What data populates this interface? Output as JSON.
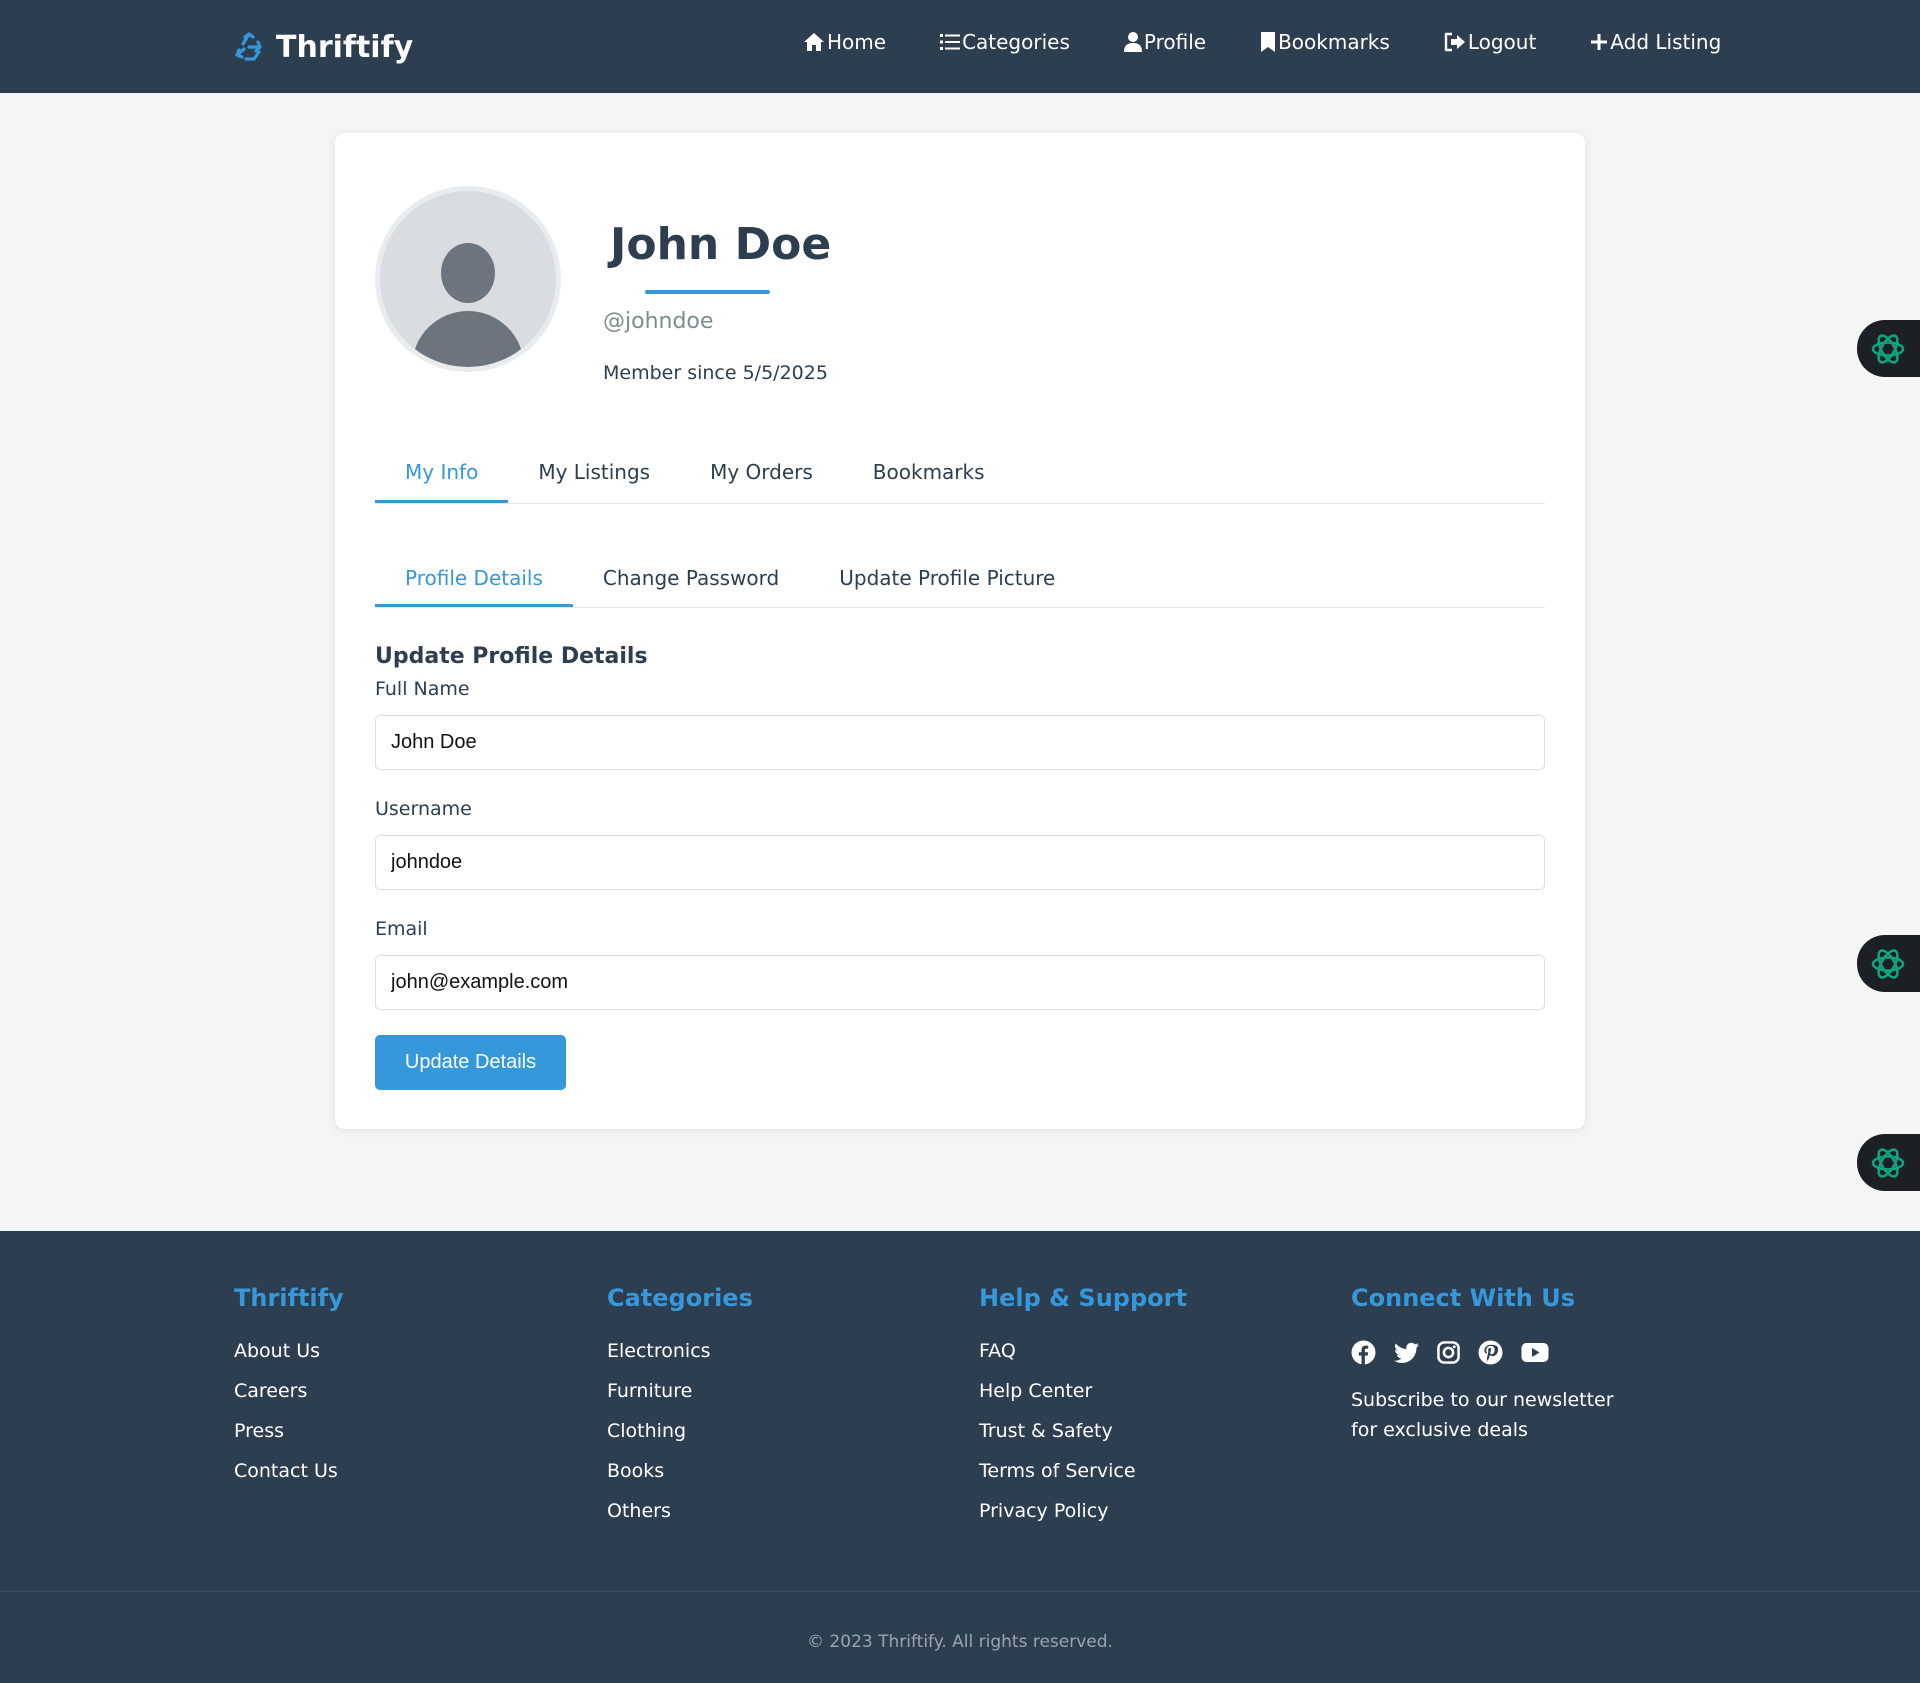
{
  "header": {
    "brand": "Thriftify",
    "nav": [
      {
        "label": "Home",
        "icon": "home-icon"
      },
      {
        "label": "Categories",
        "icon": "list-icon"
      },
      {
        "label": "Profile",
        "icon": "user-icon"
      },
      {
        "label": "Bookmarks",
        "icon": "bookmark-icon"
      },
      {
        "label": "Logout",
        "icon": "logout-icon"
      },
      {
        "label": "Add Listing",
        "icon": "plus-icon"
      }
    ]
  },
  "profile": {
    "name": "John Doe",
    "handle": "@johndoe",
    "member_since": "Member since 5/5/2025"
  },
  "tabs": {
    "primary": [
      "My Info",
      "My Listings",
      "My Orders",
      "Bookmarks"
    ],
    "secondary": [
      "Profile Details",
      "Change Password",
      "Update Profile Picture"
    ]
  },
  "form": {
    "title": "Update Profile Details",
    "full_name_label": "Full Name",
    "full_name_value": "John Doe",
    "username_label": "Username",
    "username_value": "johndoe",
    "email_label": "Email",
    "email_value": "john@example.com",
    "submit_label": "Update Details"
  },
  "footer": {
    "col1": {
      "title": "Thriftify",
      "links": [
        "About Us",
        "Careers",
        "Press",
        "Contact Us"
      ]
    },
    "col2": {
      "title": "Categories",
      "links": [
        "Electronics",
        "Furniture",
        "Clothing",
        "Books",
        "Others"
      ]
    },
    "col3": {
      "title": "Help & Support",
      "links": [
        "FAQ",
        "Help Center",
        "Trust & Safety",
        "Terms of Service",
        "Privacy Policy"
      ]
    },
    "col4": {
      "title": "Connect With Us",
      "newsletter": "Subscribe to our newsletter for exclusive deals"
    },
    "copyright": "© 2023 Thriftify. All rights reserved."
  },
  "colors": {
    "header_bg": "#2d3e50",
    "accent": "#3498db",
    "page_bg": "#f5f5f5"
  }
}
